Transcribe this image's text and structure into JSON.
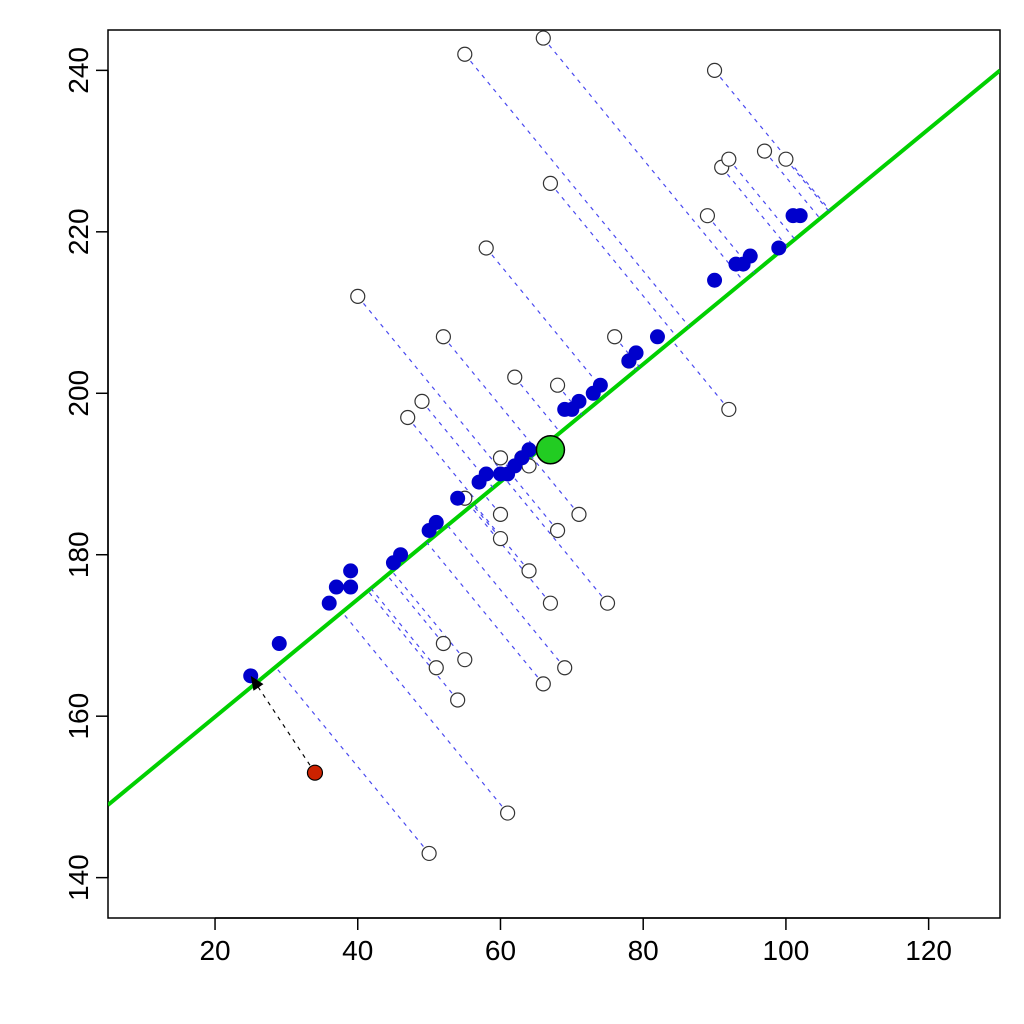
{
  "chart_data": {
    "type": "scatter",
    "title": "",
    "xlabel": "",
    "ylabel": "",
    "xlim": [
      5,
      130
    ],
    "ylim": [
      135,
      245
    ],
    "x_ticks": [
      20,
      40,
      60,
      80,
      100,
      120
    ],
    "y_ticks": [
      140,
      160,
      180,
      200,
      220,
      240
    ],
    "pc_line": {
      "x1": 5,
      "y1": 149,
      "x2": 130,
      "y2": 240
    },
    "centroid": {
      "x": 67,
      "y": 193
    },
    "highlight_raw": {
      "x": 34,
      "y": 153
    },
    "highlight_proj": {
      "x": 25,
      "y": 165
    },
    "series": [
      {
        "name": "raw_points",
        "style": "open",
        "points": [
          {
            "x": 40,
            "y": 212
          },
          {
            "x": 47,
            "y": 197
          },
          {
            "x": 50,
            "y": 143
          },
          {
            "x": 49,
            "y": 199
          },
          {
            "x": 52,
            "y": 169
          },
          {
            "x": 52,
            "y": 207
          },
          {
            "x": 51,
            "y": 166
          },
          {
            "x": 54,
            "y": 162
          },
          {
            "x": 55,
            "y": 242
          },
          {
            "x": 55,
            "y": 167
          },
          {
            "x": 55,
            "y": 187
          },
          {
            "x": 58,
            "y": 218
          },
          {
            "x": 60,
            "y": 182
          },
          {
            "x": 60,
            "y": 192
          },
          {
            "x": 61,
            "y": 148
          },
          {
            "x": 60,
            "y": 185
          },
          {
            "x": 63,
            "y": 192
          },
          {
            "x": 62,
            "y": 202
          },
          {
            "x": 64,
            "y": 191
          },
          {
            "x": 64,
            "y": 178
          },
          {
            "x": 66,
            "y": 244
          },
          {
            "x": 66,
            "y": 164
          },
          {
            "x": 67,
            "y": 226
          },
          {
            "x": 67,
            "y": 174
          },
          {
            "x": 68,
            "y": 201
          },
          {
            "x": 68,
            "y": 183
          },
          {
            "x": 69,
            "y": 166
          },
          {
            "x": 71,
            "y": 185
          },
          {
            "x": 75,
            "y": 174
          },
          {
            "x": 76,
            "y": 207
          },
          {
            "x": 78,
            "y": 204
          },
          {
            "x": 89,
            "y": 222
          },
          {
            "x": 90,
            "y": 240
          },
          {
            "x": 91,
            "y": 228
          },
          {
            "x": 92,
            "y": 229
          },
          {
            "x": 92,
            "y": 198
          },
          {
            "x": 97,
            "y": 230
          },
          {
            "x": 100,
            "y": 229
          }
        ]
      },
      {
        "name": "projected_points",
        "style": "blue",
        "points": [
          {
            "x": 25,
            "y": 165
          },
          {
            "x": 29,
            "y": 169
          },
          {
            "x": 36,
            "y": 174
          },
          {
            "x": 37,
            "y": 176
          },
          {
            "x": 39,
            "y": 176
          },
          {
            "x": 39,
            "y": 178
          },
          {
            "x": 45,
            "y": 179
          },
          {
            "x": 46,
            "y": 180
          },
          {
            "x": 50,
            "y": 183
          },
          {
            "x": 51,
            "y": 184
          },
          {
            "x": 54,
            "y": 187
          },
          {
            "x": 57,
            "y": 189
          },
          {
            "x": 58,
            "y": 190
          },
          {
            "x": 60,
            "y": 190
          },
          {
            "x": 61,
            "y": 190
          },
          {
            "x": 62,
            "y": 191
          },
          {
            "x": 63,
            "y": 192
          },
          {
            "x": 64,
            "y": 193
          },
          {
            "x": 69,
            "y": 198
          },
          {
            "x": 70,
            "y": 198
          },
          {
            "x": 71,
            "y": 199
          },
          {
            "x": 73,
            "y": 200
          },
          {
            "x": 74,
            "y": 201
          },
          {
            "x": 78,
            "y": 204
          },
          {
            "x": 79,
            "y": 205
          },
          {
            "x": 82,
            "y": 207
          },
          {
            "x": 90,
            "y": 214
          },
          {
            "x": 93,
            "y": 216
          },
          {
            "x": 94,
            "y": 216
          },
          {
            "x": 95,
            "y": 217
          },
          {
            "x": 99,
            "y": 218
          },
          {
            "x": 101,
            "y": 222
          },
          {
            "x": 102,
            "y": 222
          }
        ]
      }
    ]
  }
}
